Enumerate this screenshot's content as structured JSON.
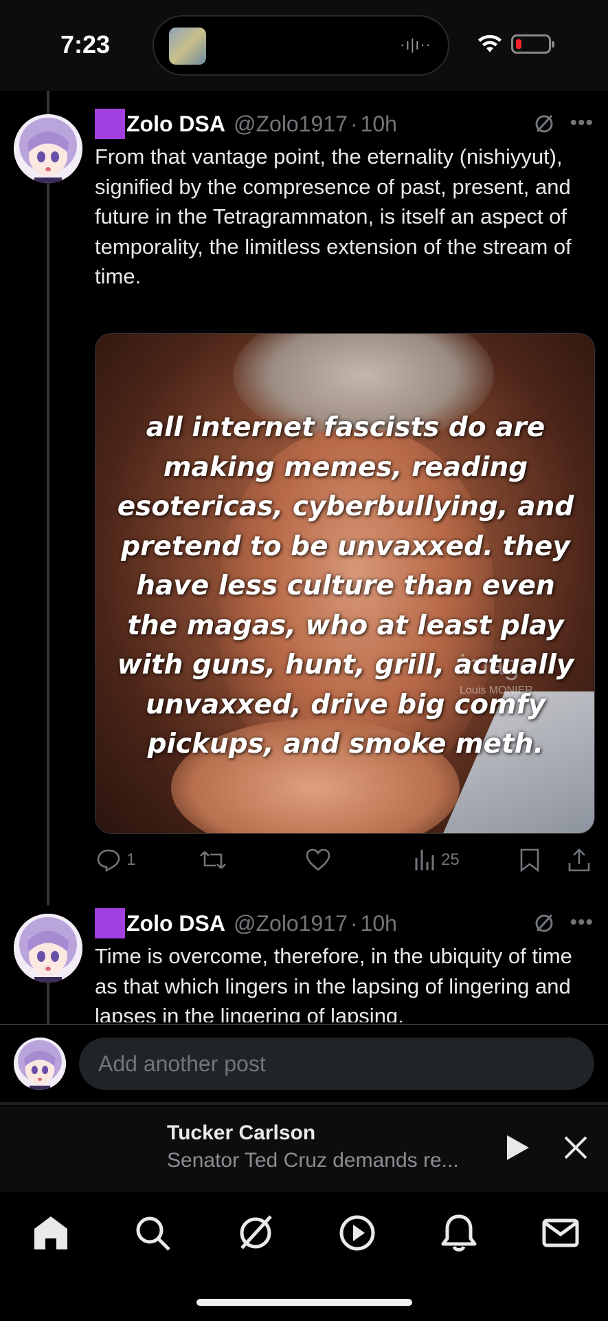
{
  "status_bar": {
    "time": "7:23",
    "island_wave": "·ı|ı··"
  },
  "colors": {
    "background": "#000000",
    "text": "#e7e9ea",
    "muted": "#71767b",
    "badge": "#a23fe0",
    "battery_low": "#f4212e"
  },
  "thread": {
    "posts": [
      {
        "name": "Zolo DSA",
        "handle": "@Zolo1917",
        "age": "10h",
        "separator": "·",
        "text": "From that vantage point, the eternality (nishiyyut), signified by the compresence of past, present, and future in the Tetragrammaton, is itself an aspect of temporality, the limitless extension of the stream of time.",
        "media": {
          "overlay_text": "all internet fascists do are making memes, reading esotericas, cyberbullying, and pretend to be unvaxxed. they have less culture than even the magas, who at least play with guns, hunt, grill, actually unvaxxed, drive big comfy pickups, and smoke meth.",
          "watermark": "image",
          "credit": "Louis MONIER"
        },
        "metrics": {
          "replies": "1",
          "reposts": "",
          "likes": "",
          "views": "25"
        }
      },
      {
        "name": "Zolo DSA",
        "handle": "@Zolo1917",
        "age": "10h",
        "separator": "·",
        "text": "Time is overcome, therefore, in the ubiquity of time as that which lingers in the lapsing of lingering and lapses in the lingering of lapsing."
      }
    ]
  },
  "composer": {
    "placeholder": "Add another post"
  },
  "player": {
    "title": "Tucker Carlson",
    "subtitle": "Senator Ted Cruz demands re..."
  },
  "tabs": [
    "home-icon",
    "search-icon",
    "grok-icon",
    "video-icon",
    "notifications-icon",
    "messages-icon"
  ]
}
